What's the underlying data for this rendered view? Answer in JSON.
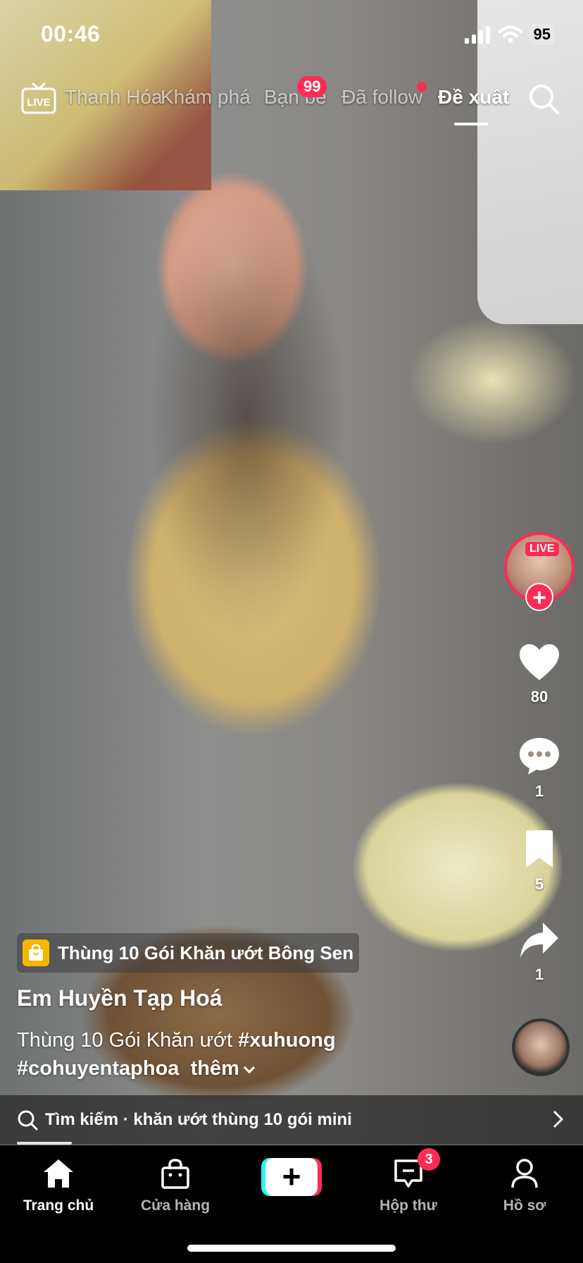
{
  "status_bar": {
    "time": "00:46",
    "battery": "95"
  },
  "top_nav": {
    "live_label": "LIVE",
    "tabs": [
      {
        "label": "Thanh Hóa"
      },
      {
        "label": "Khám phá"
      },
      {
        "label": "Bạn bè"
      },
      {
        "label": "Đã follow"
      },
      {
        "label": "Đề xuất"
      }
    ],
    "friends_badge": "99",
    "active_tab": "Đề xuất"
  },
  "right_rail": {
    "live_tag": "LIVE",
    "likes": "80",
    "comments": "1",
    "saves": "5",
    "shares": "1"
  },
  "video": {
    "product": "Thùng 10 Gói Khăn ướt Bông Sen",
    "author": "Em Huyền Tạp Hoá",
    "caption_text": "Thùng 10 Gói Khăn ướt ",
    "hashtag_1": "#xuhuong",
    "hashtag_2": "#cohuyentaphoa",
    "more": "thêm"
  },
  "search_suggestion": {
    "prefix": "Tìm kiếm",
    "separator": " · ",
    "query": "khăn ướt thùng 10 gói mini"
  },
  "bottom_nav": {
    "home": "Trang chủ",
    "shop": "Cửa hàng",
    "create": "+",
    "inbox": "Hộp thư",
    "inbox_badge": "3",
    "profile": "Hồ sơ"
  },
  "colors": {
    "accent": "#fe2c55",
    "cyan": "#25f4ee",
    "shop": "#f7b500"
  }
}
